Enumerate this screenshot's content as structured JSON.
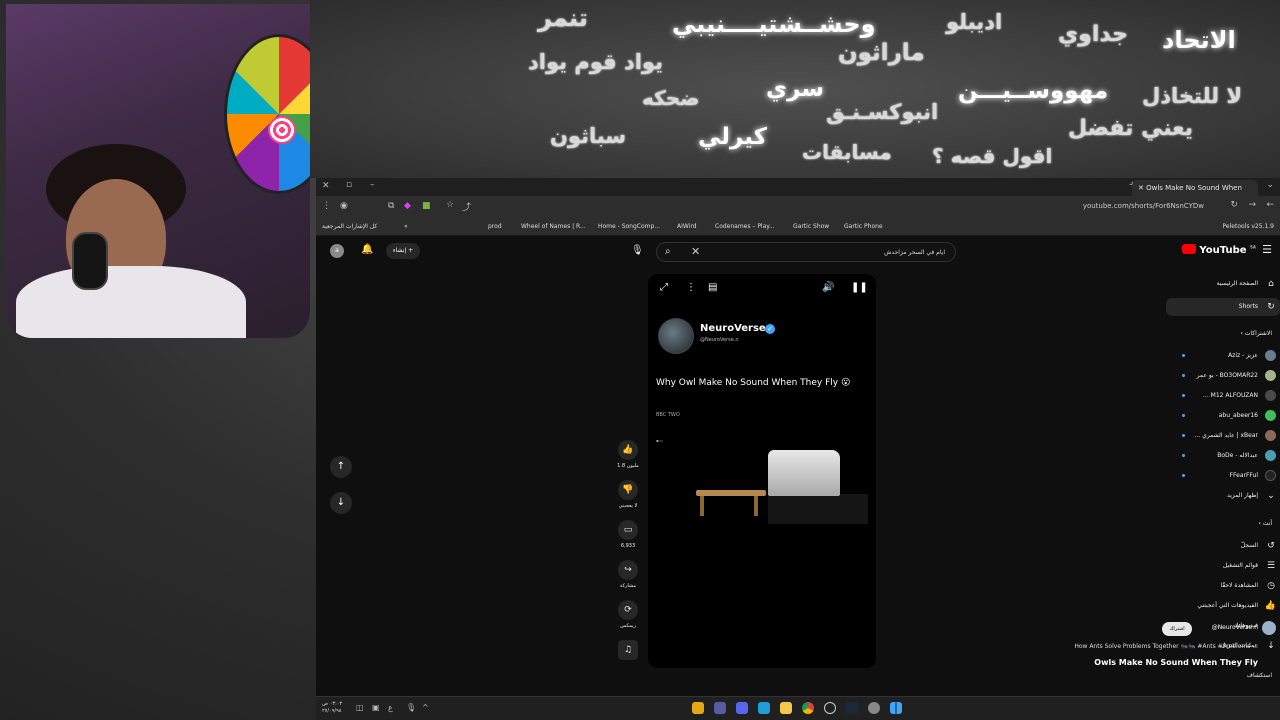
{
  "banner": {
    "words": [
      {
        "text": "تنمر",
        "bright": false
      },
      {
        "text": "وحشــشتيــــنيبي",
        "bright": true
      },
      {
        "text": "اديبلو",
        "bright": false
      },
      {
        "text": "جداوي",
        "bright": false
      },
      {
        "text": "الاتحاد",
        "bright": true
      },
      {
        "text": "يواد قوم يواد",
        "bright": false
      },
      {
        "text": "ماراثون",
        "bright": false
      },
      {
        "text": "ضحكه",
        "bright": false
      },
      {
        "text": "سري",
        "bright": true
      },
      {
        "text": "مهووســيـــن",
        "bright": true
      },
      {
        "text": "لا للتخاذل",
        "bright": false
      },
      {
        "text": "انبوكسـنـق",
        "bright": false
      },
      {
        "text": "يعني تفضل",
        "bright": false
      },
      {
        "text": "سباثون",
        "bright": false
      },
      {
        "text": "كيرلي",
        "bright": true
      },
      {
        "text": "مسابقات",
        "bright": false
      },
      {
        "text": "اقول قصه ؟",
        "bright": false
      }
    ]
  },
  "browser": {
    "active_tab": "Owls Make No Sound When",
    "url": "youtube.com/shorts/For6NsnCYDw",
    "extension_label": "Peletools v25.1.9",
    "bookmarks_all": "كل الإشارات المرجعية",
    "bookmarks": [
      "prod",
      "Wheel of Names | R...",
      "Home - SongComp...",
      "AIWird",
      "Codenames – Play...",
      "Gartic Show",
      "Gartic Phone"
    ]
  },
  "youtube": {
    "logo_text": "YouTube",
    "logo_region": "SA",
    "search_value": "ايام في السحر مزاحدش",
    "create_label": "إنشاء",
    "user_initial": "a",
    "sidebar": {
      "main": [
        {
          "label": "الصفحة الرئيسية",
          "icon": "⌂",
          "name": "home",
          "active": false
        },
        {
          "label": "Shorts",
          "icon": "↻",
          "name": "shorts",
          "active": true
        }
      ],
      "subscriptions_header": "الاشتراكات",
      "subscriptions": [
        {
          "label": "عزيز - Aziz",
          "color": "#6b7c8f"
        },
        {
          "label": "BO3OMAR22 - بو عمر",
          "color": "#a5b48c"
        },
        {
          "label": "M12 ALFOUZAN ...",
          "color": "#4a4a4a"
        },
        {
          "label": "abu_abeer16",
          "color": "#3fbf5a"
        },
        {
          "label": "xBear | عايد الشمري ...",
          "color": "#8a6a5a"
        },
        {
          "label": "عبدالاله - BoDe",
          "color": "#49a0b5"
        },
        {
          "label": "FFearFFul",
          "color": "#222222"
        }
      ],
      "show_more": "إظهار المزيد",
      "you_header": "أنت",
      "you_items": [
        {
          "label": "السجلّ",
          "icon": "↺",
          "name": "history"
        },
        {
          "label": "قوائم التشغيل",
          "icon": "☰",
          "name": "playlists"
        },
        {
          "label": "المشاهدة لاحقًا",
          "icon": "◷",
          "name": "watch-later"
        },
        {
          "label": "الفيديوهات التي أعجبتني",
          "icon": "👍",
          "name": "liked-videos"
        },
        {
          "label": "فيديوهاتك",
          "icon": "▶",
          "name": "your-videos"
        },
        {
          "label": "عمليات التنزيل",
          "icon": "↓",
          "name": "downloads"
        }
      ],
      "explore_header": "استكشاف"
    },
    "short": {
      "channel_name": "NeuroVerse",
      "channel_handle": "@NeuroVerse.n",
      "title": "Why Owl Make No Sound When They Fly 😮",
      "bbc_logo": "BBC TWO",
      "like_count": "1.8 مليون",
      "dislike_label": "لا يعجبني",
      "comment_count": "6,933",
      "share_label": "مشاركة",
      "remix_label": "ريمكس"
    },
    "next": {
      "subscribe_label": "اشتراك",
      "handle": "@NeuroVerse.n",
      "description": "How Ants Solve Problems Together 🐜🐜 #Ants #Problems ...",
      "title": "Owls Make No Sound When They Fly"
    }
  },
  "taskbar": {
    "time": "٠٣:٠٣ ص",
    "date": "٢٧/٠٩/٩٨",
    "lang": "ع"
  }
}
